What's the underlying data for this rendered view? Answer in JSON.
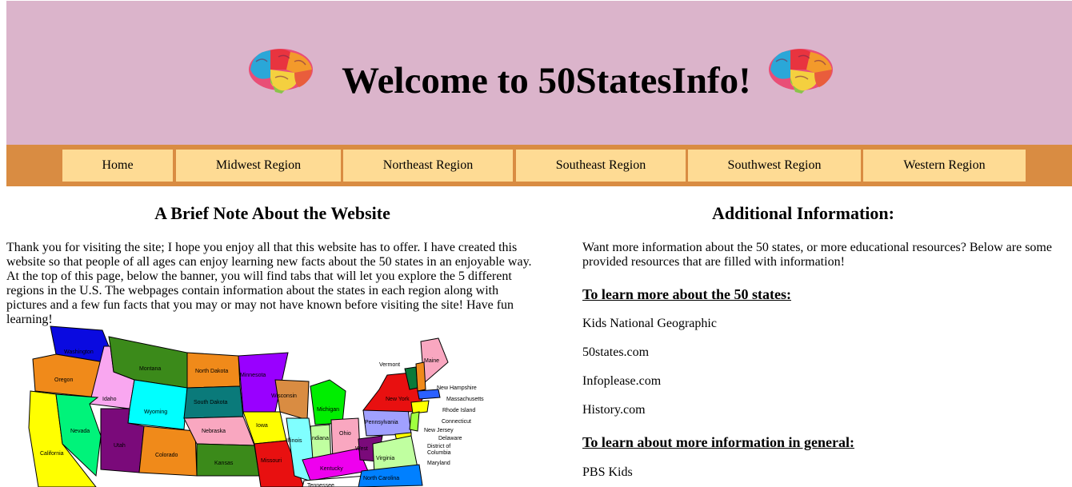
{
  "banner": {
    "title": "Welcome to 50StatesInfo!",
    "brain_icon": "colorful-brain-icon"
  },
  "nav": {
    "tabs": [
      {
        "label": "Home"
      },
      {
        "label": "Midwest Region"
      },
      {
        "label": "Northeast Region"
      },
      {
        "label": "Southeast Region"
      },
      {
        "label": "Southwest Region"
      },
      {
        "label": "Western Region"
      }
    ]
  },
  "note": {
    "heading": "A Brief Note About the Website",
    "body": "Thank you for visiting the site; I hope you enjoy all that this website has to offer. I have created this website so that people of all ages can enjoy learning new facts about the 50 states in an enjoyable way. At the top of this page, below the banner, you will find tabs that will let you explore the 5 different regions in the U.S. The webpages contain information about the states in each region along with pictures and a few fun facts that you may or may not have known before visiting the site! Have fun learning!"
  },
  "map": {
    "state_labels": [
      "Washington",
      "Oregon",
      "California",
      "Idaho",
      "Nevada",
      "Montana",
      "Wyoming",
      "Utah",
      "Colorado",
      "North Dakota",
      "South Dakota",
      "Nebraska",
      "Kansas",
      "Minnesota",
      "Iowa",
      "Missouri",
      "Wisconsin",
      "Illinois",
      "Michigan",
      "Indiana",
      "Ohio",
      "Kentucky",
      "Tennessee",
      "Pennsylvania",
      "New York",
      "Vermont",
      "Maine",
      "New Hampshire",
      "Massachusetts",
      "Rhode Island",
      "Connecticut",
      "New Jersey",
      "Delaware",
      "District of Columbia",
      "Maryland",
      "West Virginia",
      "Virginia",
      "North Carolina"
    ]
  },
  "info": {
    "heading": "Additional Information:",
    "intro": "Want more information about the 50 states, or more educational resources? Below are some provided resources that are filled with information!",
    "states_heading": "To learn more about the 50 states:",
    "states_links": [
      {
        "label": "Kids National Geographic"
      },
      {
        "label": "50states.com"
      },
      {
        "label": "Infoplease.com"
      },
      {
        "label": "History.com"
      }
    ],
    "general_heading": "To learn about more information in general:",
    "general_links": [
      {
        "label": "PBS Kids"
      }
    ]
  },
  "colors": {
    "banner_bg": "#dbb4cb",
    "nav_bg": "#d98c42",
    "tab_bg": "#fedb94"
  }
}
